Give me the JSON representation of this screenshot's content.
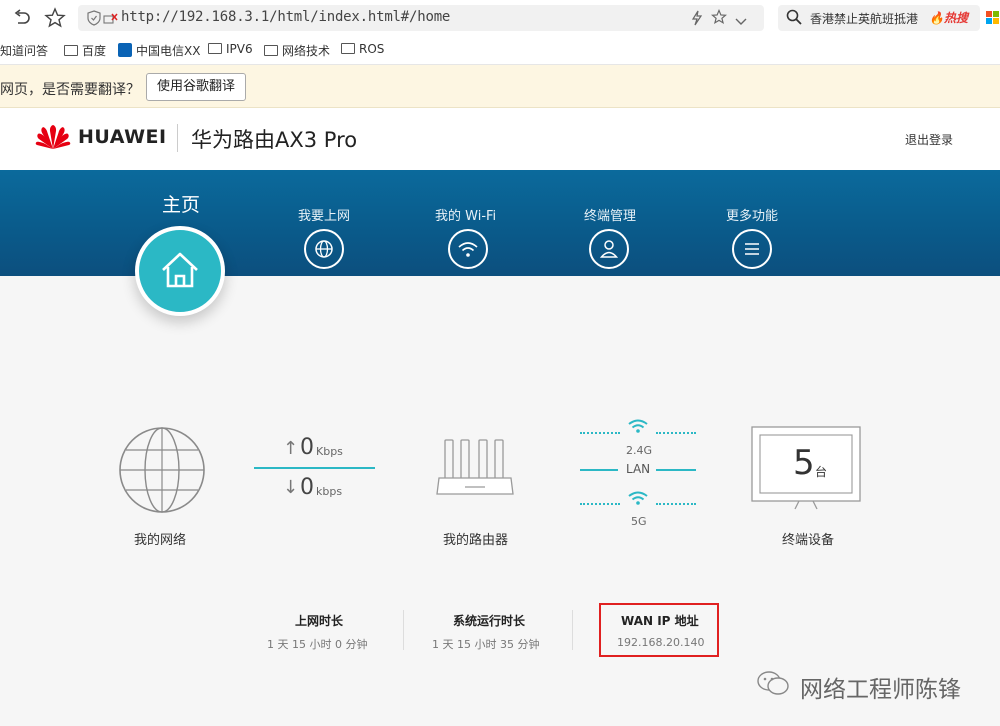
{
  "browser": {
    "url": "http://192.168.3.1/html/index.html#/home",
    "search_text": "香港禁止英航班抵港",
    "hot_badge": "热搜",
    "bookmarks": [
      "知道问答",
      "百度",
      "中国电信XX",
      "IPV6",
      "网络技术",
      "ROS"
    ],
    "translate_prompt": "网页，是否需要翻译？",
    "translate_button": "使用谷歌翻译"
  },
  "header": {
    "brand": "HUAWEI",
    "product": "华为路由AX3 Pro",
    "logout": "退出登录"
  },
  "nav": {
    "home": "主页",
    "items": [
      "我要上网",
      "我的 Wi-Fi",
      "终端管理",
      "更多功能"
    ]
  },
  "status": {
    "network_label": "我的网络",
    "upload_value": "0",
    "upload_unit": "Kbps",
    "download_value": "0",
    "download_unit": "kbps",
    "router_label": "我的路由器",
    "band_24": "2.4G",
    "lan_label": "LAN",
    "band_5": "5G",
    "device_count": "5",
    "device_unit": "台",
    "devices_label": "终端设备"
  },
  "stats": [
    {
      "label": "上网时长",
      "value": "1 天 15 小时 0 分钟"
    },
    {
      "label": "系统运行时长",
      "value": "1 天 15 小时 35 分钟"
    },
    {
      "label": "WAN IP 地址",
      "value": "192.168.20.140"
    }
  ],
  "highlight_color": "#e02020",
  "accent_color": "#2bb8c5",
  "watermark": "网络工程师陈锋"
}
